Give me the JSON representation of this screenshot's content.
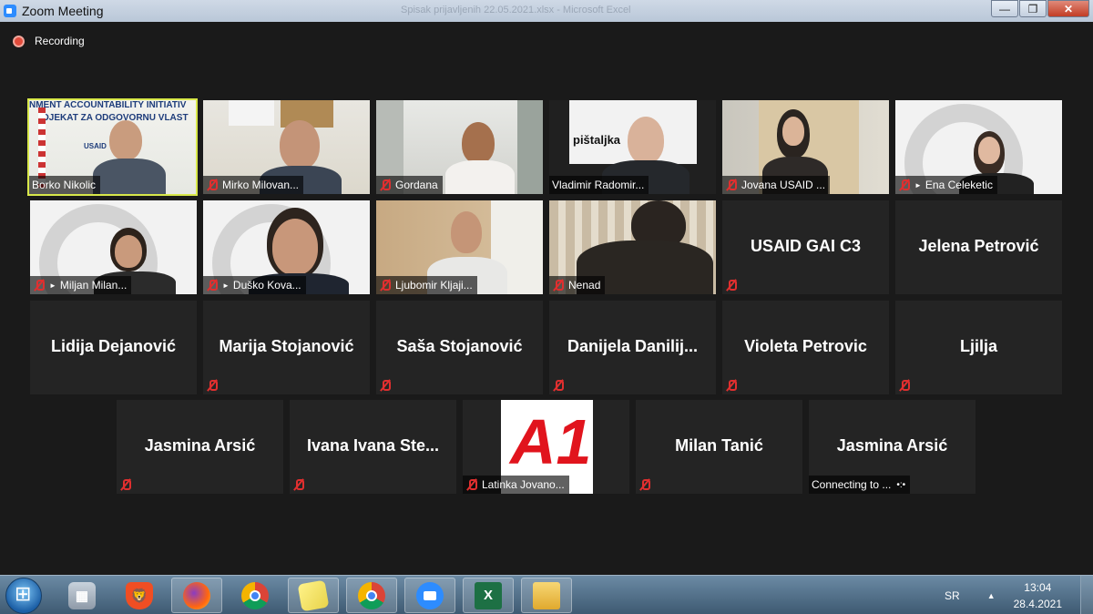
{
  "window": {
    "title": "Zoom Meeting",
    "background_title": "Spisak prijavljenih 22.05.2021.xlsx - Microsoft Excel",
    "controls": {
      "minimize": "—",
      "maximize": "❐",
      "close": "✕"
    }
  },
  "recording": {
    "label": "Recording"
  },
  "participants": [
    {
      "label": "Borko Nikolic",
      "muted": false,
      "video": true,
      "active": true,
      "banner_text_1": "NMENT ACCOUNTABILITY INITIATIV",
      "banner_text_2": "OJEKAT ZA ODGOVORNU VLAST",
      "banner_text_3": "USAID"
    },
    {
      "label": "Mirko Milovan...",
      "muted": true,
      "video": true
    },
    {
      "label": "Gordana",
      "muted": true,
      "video": true
    },
    {
      "label": "Vladimir Radomir...",
      "muted": false,
      "video": true,
      "sign_text": "pištaljka"
    },
    {
      "label": "Jovana USAID ...",
      "muted": true,
      "video": true
    },
    {
      "label": "Ena Celeketic",
      "muted": true,
      "video": true,
      "arrow": true
    },
    {
      "label": "Miljan Milan...",
      "muted": true,
      "video": true,
      "arrow": true
    },
    {
      "label": "Duško Kova...",
      "muted": true,
      "video": true,
      "arrow": true
    },
    {
      "label": "Ljubomir Kljaji...",
      "muted": true,
      "video": true
    },
    {
      "label": "Nenad",
      "muted": true,
      "video": true
    },
    {
      "big_name": "USAID GAI C3",
      "muted": true
    },
    {
      "big_name": "Jelena Petrović",
      "muted": false
    },
    {
      "big_name": "Lidija Dejanović",
      "muted": false
    },
    {
      "big_name": "Marija Stojanović",
      "muted": true
    },
    {
      "big_name": "Saša Stojanović",
      "muted": true
    },
    {
      "big_name": "Danijela Danilij...",
      "muted": true
    },
    {
      "big_name": "Violeta Petrovic",
      "muted": true
    },
    {
      "big_name": "Ljilja",
      "muted": true
    },
    {
      "big_name": "Jasmina Arsić",
      "muted": true
    },
    {
      "big_name": "Ivana Ivana Ste...",
      "muted": true
    },
    {
      "label": "Latinka Jovano...",
      "muted": true,
      "logo": "A1"
    },
    {
      "big_name": "Milan Tanić",
      "muted": true
    },
    {
      "big_name": "Jasmina Arsić",
      "label": "Connecting to ...",
      "connecting": true
    }
  ],
  "taskbar": {
    "apps": [
      {
        "name": "calculator-icon",
        "open": false
      },
      {
        "name": "brave-icon",
        "open": false
      },
      {
        "name": "firefox-icon",
        "open": true
      },
      {
        "name": "chrome-icon",
        "open": false
      },
      {
        "name": "sticky-notes-icon",
        "open": true
      },
      {
        "name": "chrome-icon",
        "open": true
      },
      {
        "name": "zoom-icon",
        "open": true
      },
      {
        "name": "excel-icon",
        "open": true
      },
      {
        "name": "explorer-icon",
        "open": true
      }
    ],
    "language": "SR",
    "time": "13:04",
    "date": "28.4.2021"
  },
  "colors": {
    "active_speaker": "#d8e84a",
    "mute": "#e02f2f",
    "tile_bg": "#242424",
    "recording": "#e24b3b"
  }
}
